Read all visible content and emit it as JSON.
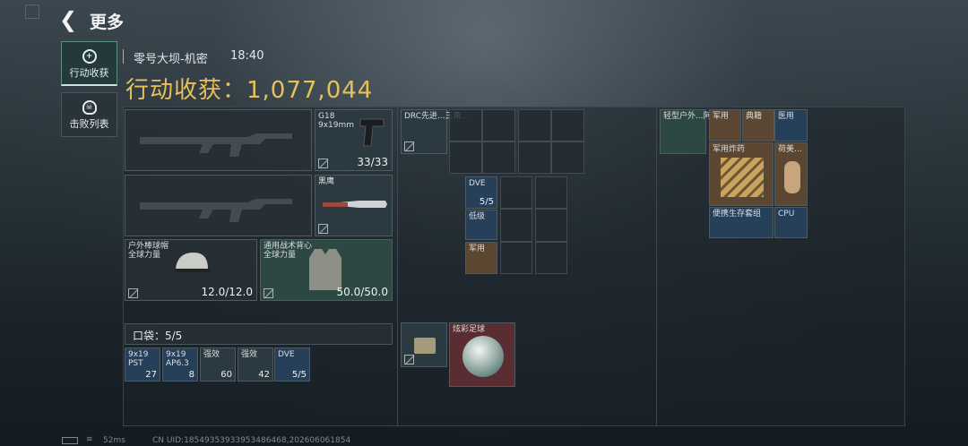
{
  "header": {
    "back_icon": "chevron-left-icon",
    "title": "更多"
  },
  "tabs": [
    {
      "label": "行动收获",
      "icon": "circle-plus-icon",
      "active": true
    },
    {
      "label": "击败列表",
      "icon": "skull-icon",
      "active": false
    }
  ],
  "raid": {
    "map": "零号大坝-机密",
    "time": "18:40",
    "haul_label": "行动收获：1,077,044"
  },
  "equipment": {
    "pistol": {
      "name": "G18",
      "caliber": "9x19mm",
      "ammo": "33/33"
    },
    "knife": {
      "name": "黑鹰"
    },
    "helmet": {
      "name": "户外棒球帽",
      "sub": "全球力量",
      "durability": "12.0/12.0"
    },
    "armor": {
      "name": "通用战术背心",
      "sub": "全球力量",
      "durability": "50.0/50.0"
    }
  },
  "pockets": {
    "label": "口袋：5/5",
    "items": [
      {
        "top": "9x19",
        "mid": "PST",
        "count": "27"
      },
      {
        "top": "9x19",
        "mid": "AP6.3",
        "count": "8"
      },
      {
        "top": "强效",
        "count": "60"
      },
      {
        "top": "强效",
        "count": "42"
      },
      {
        "top": "DVE",
        "count": "5/5"
      }
    ]
  },
  "chest_rig": {
    "name": "DRC先进...三角..."
  },
  "rig_items": [
    {
      "name": "DVE",
      "count": "5/5"
    },
    {
      "name": "低级"
    },
    {
      "name": "军用"
    }
  ],
  "secure": {
    "name": "炫彩足球"
  },
  "backpack": {
    "name": "轻型户外...阿...",
    "items": [
      {
        "name": "军用"
      },
      {
        "name": "典籍"
      },
      {
        "name": "医用"
      },
      {
        "name": "军用炸药"
      },
      {
        "name": "荷美..."
      },
      {
        "name": "便携生存套组"
      },
      {
        "name": "CPU"
      }
    ]
  },
  "footer": {
    "ping": "52ms",
    "uid": "CN UID:18549353933953486468,202606061854"
  },
  "colors": {
    "accent": "#e7c05a",
    "tab_active": "#243a3a",
    "red_slot": "#5a2d32"
  }
}
